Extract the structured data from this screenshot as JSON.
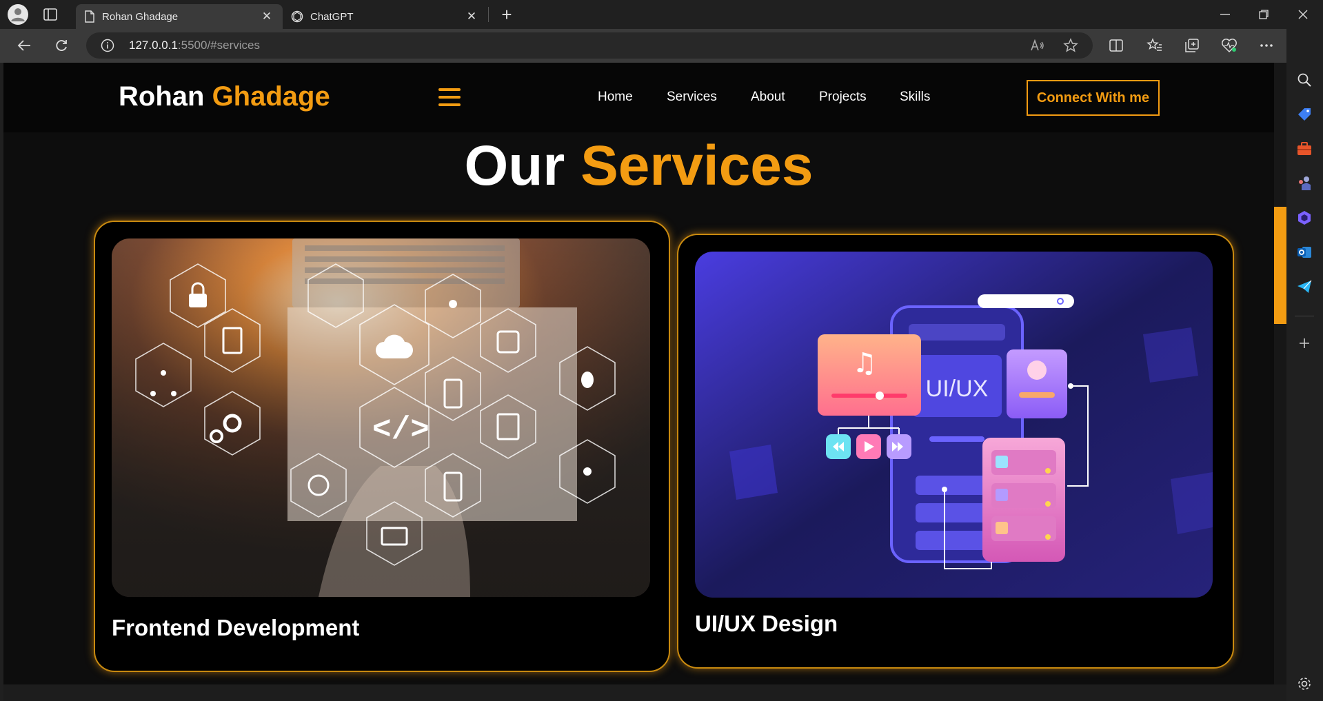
{
  "browser": {
    "tabs": [
      {
        "title": "Rohan Ghadage",
        "active": true
      },
      {
        "title": "ChatGPT",
        "active": false
      }
    ],
    "url_host": "127.0.0.1",
    "url_rest": ":5500/#services"
  },
  "site": {
    "logo_first": "Rohan",
    "logo_last": "Ghadage",
    "nav": [
      "Home",
      "Services",
      "About",
      "Projects",
      "Skills"
    ],
    "cta": "Connect With me",
    "accent": "#f39c12"
  },
  "services": {
    "heading_white": "Our",
    "heading_orange": "Services",
    "cards": [
      {
        "title": "Frontend Development"
      },
      {
        "title": "UI/UX Design",
        "image_text": "UI/UX"
      }
    ]
  }
}
